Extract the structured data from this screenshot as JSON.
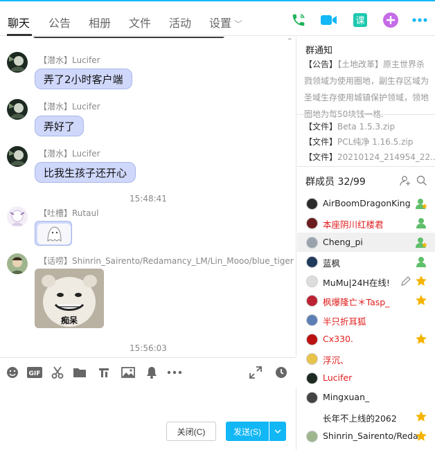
{
  "tabs": [
    {
      "label": "聊天"
    },
    {
      "label": "公告"
    },
    {
      "label": "相册"
    },
    {
      "label": "文件"
    },
    {
      "label": "活动"
    },
    {
      "label": "设置"
    }
  ],
  "top_icons": [
    "phone-icon",
    "video-icon",
    "class-icon",
    "add-app-icon",
    "more-icon"
  ],
  "top_icons_labels": {
    "class": "课"
  },
  "messages": [
    {
      "sender": "【潜水】Lucifer",
      "text": "弄了2小时客户端"
    },
    {
      "sender": "【潜水】Lucifer",
      "text": "弄好了"
    },
    {
      "sender": "【潜水】Lucifer",
      "text": "比我生孩子还开心"
    },
    {
      "time": "15:48:41"
    },
    {
      "sender": "【吐槽】Rutaul",
      "sticker": "ghost-sticker"
    },
    {
      "sender": "【话唠】Shinrin_Sairento/Redamancy_LM/Lin_Mooo/blue_tiger",
      "sticker": "bear-meme-sticker",
      "sticker_caption": "痴呆"
    },
    {
      "time": "15:56:03"
    }
  ],
  "toolbar": [
    "emoji-icon",
    "gif-icon",
    "scissors-icon",
    "folder-icon",
    "music-icon",
    "image-icon",
    "bell-icon",
    "more-dots-icon",
    "expand-icon",
    "history-icon"
  ],
  "toolbar_gif": "GIF",
  "buttons": {
    "close": "关闭(C)",
    "send": "发送(S)"
  },
  "notice": {
    "title": "群通知",
    "tag": "【公告】",
    "text": "【土地改革】原主世界杀戮领域为使用圈地，副生存区域为圣域生存使用城镇保护领域，领地圈地为每50块钱一格."
  },
  "files": [
    {
      "tag": "【文件】",
      "name": "Beta 1.5.3.zip"
    },
    {
      "tag": "【文件】",
      "name": "PCL纯净 1.16.5.zip"
    },
    {
      "tag": "【文件】",
      "name": "20210124_214954_22..."
    }
  ],
  "members_header": {
    "title": "群成员",
    "count": "32/99"
  },
  "members": [
    {
      "name": "AirBoomDragonKing",
      "color": "#222222",
      "badge": "admin-star"
    },
    {
      "name": "本座阴川红楼君",
      "color": "#e11d1d",
      "badge": "admin"
    },
    {
      "name": "Cheng_pi",
      "color": "#222222",
      "badge": "admin-star"
    },
    {
      "name": "蓝枫",
      "color": "#222222",
      "badge": "admin"
    },
    {
      "name": "MuMu|24H在线!",
      "color": "#222222",
      "badge": "star"
    },
    {
      "name": "枫爆隆亡＊Tasp_",
      "color": "#e11d1d",
      "badge": "star"
    },
    {
      "name": "半只折耳狐",
      "color": "#e11d1d",
      "badge": ""
    },
    {
      "name": "Cx330.",
      "color": "#e11d1d",
      "badge": "star"
    },
    {
      "name": "浮沉、",
      "color": "#e11d1d",
      "badge": ""
    },
    {
      "name": "Lucifer",
      "color": "#e11d1d",
      "badge": ""
    },
    {
      "name": "Mingxuan_",
      "color": "#222222",
      "badge": ""
    },
    {
      "name": "长年不上线的2062",
      "color": "#222222",
      "badge": "star"
    },
    {
      "name": "Shinrin_Sairento/Reda",
      "color": "#222222",
      "badge": "star"
    }
  ]
}
